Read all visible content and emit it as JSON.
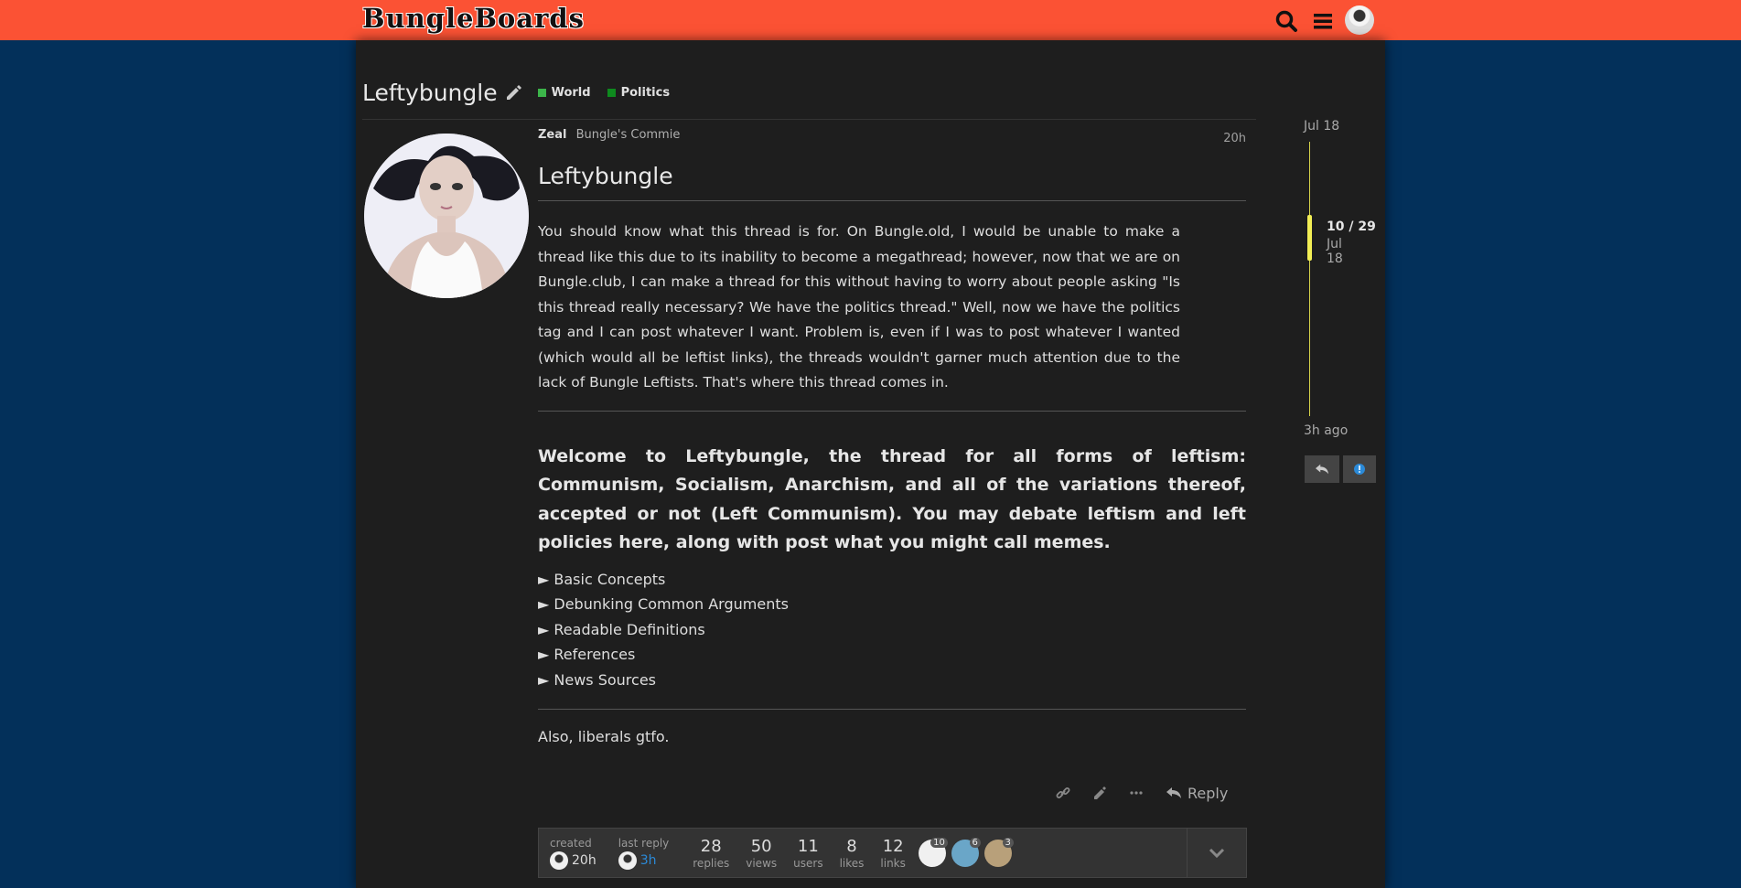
{
  "header": {
    "logo": "BungleBoards"
  },
  "topic": {
    "title": "Leftybungle",
    "tags": [
      {
        "label": "World",
        "color": "#3cb54a"
      },
      {
        "label": "Politics",
        "color": "#0e8a1e"
      }
    ]
  },
  "post": {
    "username": "Zeal",
    "user_title": "Bungle's Commie",
    "age": "20h",
    "heading": "Leftybungle",
    "intro": "You should know what this thread is for. On Bungle.old, I would be unable to make a thread like this due to its inability to become a megathread; however, now that we are on Bungle.club, I can make a thread for this without having to worry about people asking \"Is this thread really necessary? We have the politics thread.\" Well, now we have the politics tag and I can post whatever I want. Problem is, even if I was to post whatever I wanted (which would all be leftist links), the threads wouldn't garner much attention due to the lack of Bungle Leftists. That's where this thread comes in.",
    "welcome": "Welcome to Leftybungle, the thread for all forms of leftism: Communism, Socialism, Anarchism, and all of the variations thereof, accepted or not (Left Communism). You may debate leftism and left policies here, along with post what you might call memes.",
    "details": [
      "► Basic Concepts",
      "► Debunking Common Arguments",
      "► Readable Definitions",
      "► References",
      "► News Sources"
    ],
    "outro": "Also, liberals gtfo.",
    "reply_label": "Reply"
  },
  "topic_map": {
    "created_label": "created",
    "created_value": "20h",
    "last_reply_label": "last reply",
    "last_reply_value": "3h",
    "stats": [
      {
        "num": "28",
        "label": "replies"
      },
      {
        "num": "50",
        "label": "views"
      },
      {
        "num": "11",
        "label": "users"
      },
      {
        "num": "8",
        "label": "likes"
      },
      {
        "num": "12",
        "label": "links"
      }
    ],
    "participants": [
      {
        "count": "10"
      },
      {
        "count": "6"
      },
      {
        "count": "3"
      }
    ]
  },
  "timeline": {
    "start_date": "Jul 18",
    "position": "10 / 29",
    "position_date": "Jul 18",
    "end_label": "3h ago"
  },
  "colors": {
    "header": "#fb5234",
    "background": "#03305a",
    "panel": "#1e1e1e",
    "timeline": "#f2ee55"
  }
}
